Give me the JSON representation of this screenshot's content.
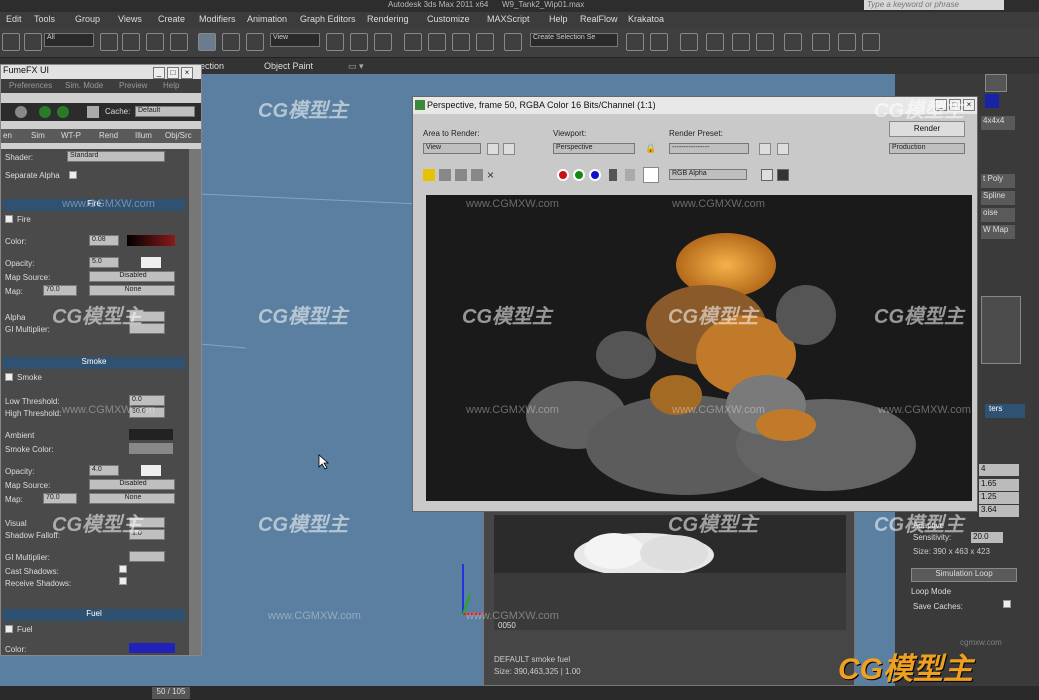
{
  "window": {
    "title": "Autodesk 3ds Max 2011 x64",
    "file": "W9_Tank2_Wip01.max",
    "search_placeholder": "Type a keyword or phrase"
  },
  "menu": [
    "Edit",
    "Tools",
    "Group",
    "Views",
    "Create",
    "Modifiers",
    "Animation",
    "Graph Editors",
    "Rendering",
    "Customize",
    "MAXScript",
    "Help",
    "RealFlow",
    "Krakatoa"
  ],
  "toolbar": {
    "selection_filter": "All",
    "ref_coord": "View",
    "named_selection": "Create Selection Se"
  },
  "view_tabs": [
    "ection",
    "Object Paint"
  ],
  "fumefx": {
    "title": "FumeFX UI",
    "menu": [
      "Preferences",
      "Sim. Mode",
      "Preview",
      "Help"
    ],
    "cache_label": "Cache:",
    "cache_value": "Default",
    "tabs": [
      "en",
      "Sim",
      "WT-P",
      "Rend",
      "Illum",
      "Obj/Src"
    ],
    "shader_label": "Shader:",
    "shader_value": "Standard",
    "separate_alpha": "Separate Alpha",
    "fire": {
      "header": "Fire",
      "checkbox": "Fire",
      "color_label": "Color:",
      "color_value": "0.08",
      "opacity_label": "Opacity:",
      "opacity_value": "5.0",
      "map_source_label": "Map Source:",
      "map_source_value": "Disabled",
      "map_label": "Map:",
      "map_amount": "70.0",
      "map_value": "None",
      "alpha_label": "Alpha",
      "gi_label": "GI Multiplier:"
    },
    "smoke": {
      "header": "Smoke",
      "checkbox": "Smoke",
      "low_label": "Low Threshold:",
      "low_value": "0.0",
      "high_label": "High Threshold:",
      "high_value": "30.0",
      "ambient_label": "Ambient",
      "smoke_color_label": "Smoke Color:",
      "opacity_label": "Opacity:",
      "opacity_value": "4.0",
      "map_source_label": "Map Source:",
      "map_source_value": "Disabled",
      "map_label": "Map:",
      "map_amount": "70.0",
      "map_value": "None",
      "visual_label": "Visual",
      "shadow_falloff_label": "Shadow Falloff:",
      "shadow_falloff_value": "1.0",
      "gi_label": "GI Multiplier:",
      "cast_shadows": "Cast Shadows:",
      "receive_shadows": "Receive Shadows:"
    },
    "fuel": {
      "header": "Fuel",
      "checkbox": "Fuel",
      "color_label": "Color:"
    }
  },
  "render_window": {
    "title": "Perspective, frame 50, RGBA Color 16 Bits/Channel (1:1)",
    "area_label": "Area to Render:",
    "area_value": "View",
    "viewport_label": "Viewport:",
    "viewport_value": "Perspective",
    "preset_label": "Render Preset:",
    "preset_value": "----------------",
    "render_button": "Render",
    "production_value": "Production",
    "channel_value": "RGB Alpha"
  },
  "frame_window": {
    "frame": "0050",
    "info1": "DEFAULT smoke fuel",
    "info2": "Size: 390,463,325 | 1.00"
  },
  "command_panel": {
    "items": [
      "4x4x4",
      "t Poly",
      "Spline",
      "oise",
      "W Map"
    ],
    "tab": "ters",
    "values": [
      "4",
      "1.65",
      "1.25",
      "3.64"
    ],
    "adaptive": "Adaptive",
    "sensitivity_label": "Sensitivity:",
    "sensitivity_value": "20.0",
    "size": "Size: 390 x 463 x 423",
    "sim_button": "Simulation Loop",
    "loop_mode": "Loop Mode",
    "save_caches": "Save Caches:"
  },
  "status": {
    "frame_indicator": "50 / 105"
  },
  "watermark": {
    "logo": "CG模型主",
    "url": "www.CGMXW.com",
    "corner_url": "cgmxw.com"
  },
  "colors": {
    "viewport": "#5a7fa0",
    "section_header": "#2f5273",
    "fire_orange": "#e8962a"
  }
}
